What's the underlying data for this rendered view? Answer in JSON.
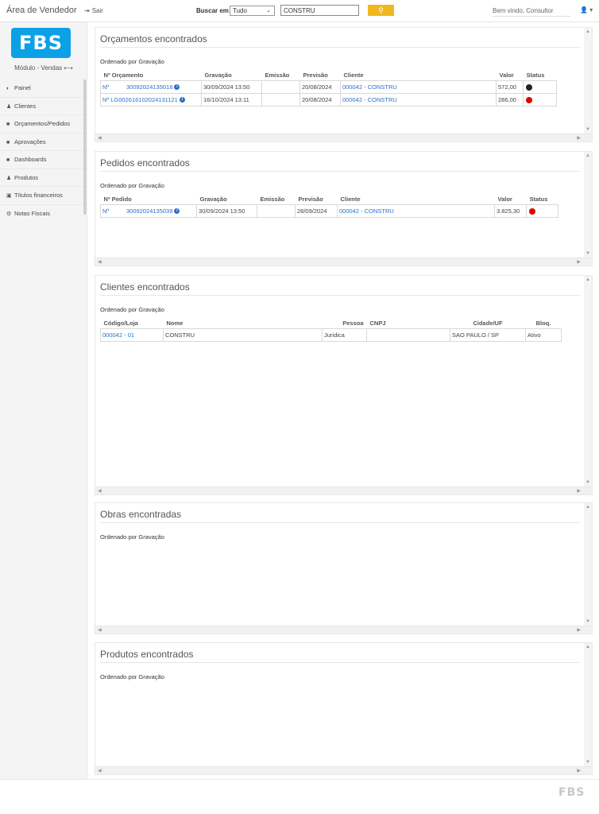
{
  "topbar": {
    "app_title": "Área de Vendedor",
    "logout_label": "Sair",
    "search_label": "Buscar em",
    "search_scope": "Tudo",
    "search_value": "CONSTRU",
    "welcome": "Bem vindo, Consultor"
  },
  "sidebar": {
    "logo": "FBS",
    "module": "Módulo - Vendas",
    "items": [
      {
        "label": "Painel",
        "icon": "dashboard-icon"
      },
      {
        "label": "Clientes",
        "icon": "users-icon"
      },
      {
        "label": "Orçamentos/Pedidos",
        "icon": "folder-icon"
      },
      {
        "label": "Aprovações",
        "icon": "folder-icon"
      },
      {
        "label": "Dashboards",
        "icon": "folder-icon"
      },
      {
        "label": "Produtos",
        "icon": "users-icon"
      },
      {
        "label": "Títulos financeiros",
        "icon": "money-icon"
      },
      {
        "label": "Notas Fiscais",
        "icon": "gear-icon"
      }
    ]
  },
  "orcamentos": {
    "title": "Orçamentos encontrados",
    "order": "Ordenado por Gravação",
    "headers": [
      "Nº Orçamento",
      "Gravação",
      "Emissão",
      "Previsão",
      "Cliente",
      "Valor",
      "Status"
    ],
    "rows": [
      {
        "prefix": "Nº",
        "number": "30092024135018",
        "gravacao": "30/09/2024 13:50",
        "emissao": "",
        "previsao": "20/08/2024",
        "cliente": "000042 - CONSTRU",
        "valor": "572,00",
        "status_color": "#222222"
      },
      {
        "prefix": "Nº",
        "number": "LG002616102024131121",
        "gravacao": "16/10/2024 13:11",
        "emissao": "",
        "previsao": "20/08/2024",
        "cliente": "000042 - CONSTRU",
        "valor": "286,00",
        "status_color": "#e30000"
      }
    ]
  },
  "pedidos": {
    "title": "Pedidos encontrados",
    "order": "Ordenado por Gravação",
    "headers": [
      "Nº Pedido",
      "Gravação",
      "Emissão",
      "Previsão",
      "Cliente",
      "Valor",
      "Status"
    ],
    "rows": [
      {
        "prefix": "Nº",
        "number": "30092024135039",
        "gravacao": "30/09/2024 13:50",
        "emissao": "",
        "previsao": "28/09/2024",
        "cliente": "000042 - CONSTRU",
        "valor": "3.825,30",
        "status_color": "#e30000"
      }
    ]
  },
  "clientes": {
    "title": "Clientes encontrados",
    "order": "Ordenado por Gravação",
    "headers": [
      "Código/Loja",
      "Nome",
      "Pessoa",
      "CNPJ",
      "Cidade/UF",
      "Bloq."
    ],
    "rows": [
      {
        "codigo": "000042 - 01",
        "nome": "CONSTRU",
        "pessoa": "Juridica",
        "cnpj": "",
        "cidade": "SAO PAULO / SP",
        "bloq": "Ativo"
      }
    ]
  },
  "obras": {
    "title": "Obras encontradas",
    "order": "Ordenado por Gravação"
  },
  "produtos": {
    "title": "Produtos encontrados",
    "order": "Ordenado por Gravação"
  },
  "footer": {
    "logo": "FBS"
  }
}
